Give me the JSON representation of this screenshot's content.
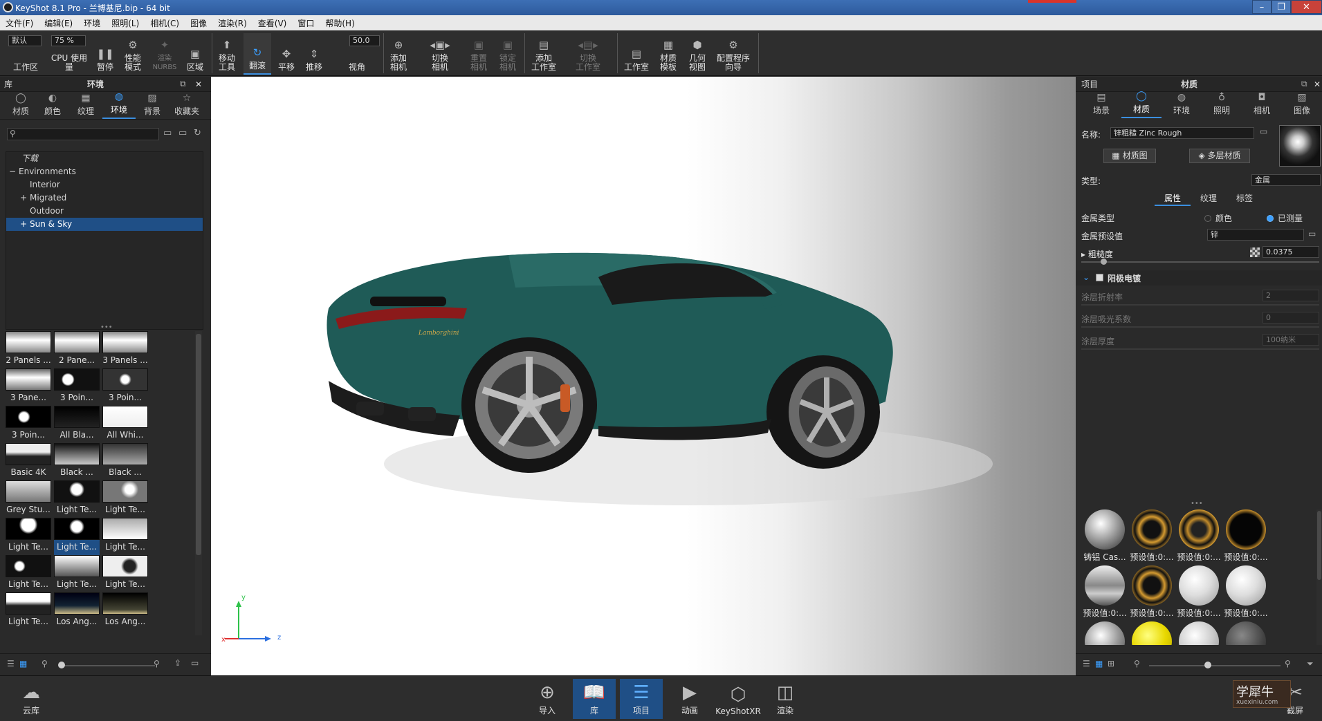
{
  "window": {
    "title": "KeyShot 8.1 Pro  - 兰博基尼.bip  - 64 bit"
  },
  "menu": [
    "文件(F)",
    "编辑(E)",
    "环境",
    "照明(L)",
    "相机(C)",
    "图像",
    "渲染(R)",
    "查看(V)",
    "窗口",
    "帮助(H)"
  ],
  "toolbar": {
    "workspace_select": "默认",
    "cpu_percent": "75 %",
    "fov_value": "50.0",
    "items": [
      {
        "label": "工作区"
      },
      {
        "label": "CPU 使用量"
      },
      {
        "label": "暂停"
      },
      {
        "label": "性能\n模式"
      },
      {
        "label": "渲染\nNURBS"
      },
      {
        "label": "区域"
      },
      {
        "label": "移动\n工具"
      },
      {
        "label": "翻滚"
      },
      {
        "label": "平移"
      },
      {
        "label": "推移"
      },
      {
        "label": "视角"
      },
      {
        "label": "添加\n相机"
      },
      {
        "label": "切换\n相机"
      },
      {
        "label": "重置\n相机"
      },
      {
        "label": "锁定\n相机"
      },
      {
        "label": "添加\n工作室"
      },
      {
        "label": "切换\n工作室"
      },
      {
        "label": "工作室"
      },
      {
        "label": "材质\n模板"
      },
      {
        "label": "几何\n视图"
      },
      {
        "label": "配置程序\n向导"
      }
    ]
  },
  "library": {
    "header_left": "库",
    "header_title": "环境",
    "tabs": [
      {
        "label": "材质"
      },
      {
        "label": "颜色"
      },
      {
        "label": "纹理"
      },
      {
        "label": "环境"
      },
      {
        "label": "背景"
      },
      {
        "label": "收藏夹"
      }
    ],
    "search_placeholder": "",
    "tree": [
      {
        "label": "下载",
        "indent": 1
      },
      {
        "label": "Environments",
        "indent": 0,
        "toggle": "−"
      },
      {
        "label": "Interior",
        "indent": 1
      },
      {
        "label": "Migrated",
        "indent": 1,
        "toggle": "+"
      },
      {
        "label": "Outdoor",
        "indent": 1
      },
      {
        "label": "Sun & Sky",
        "indent": 1,
        "toggle": "+"
      }
    ],
    "thumbs": [
      "2 Panels ...",
      "2 Pane...",
      "3 Panels ...",
      "3 Pane...",
      "3 Poin...",
      "3 Poin...",
      "3 Poin...",
      "All Bla...",
      "All Whi...",
      "Basic 4K",
      "Black ...",
      "Black ...",
      "Grey Stu...",
      "Light Te...",
      "Light Te...",
      "Light Te...",
      "Light Te...",
      "Light Te...",
      "Light Te...",
      "Light Te...",
      "Light Te...",
      "Light Te...",
      "Los Ang...",
      "Los Ang..."
    ]
  },
  "project": {
    "header_left": "项目",
    "header_title": "材质",
    "tabs": [
      {
        "label": "场景"
      },
      {
        "label": "材质"
      },
      {
        "label": "环境"
      },
      {
        "label": "照明"
      },
      {
        "label": "相机"
      },
      {
        "label": "图像"
      }
    ],
    "name_label": "名称:",
    "name_value": "锌粗糙 Zinc Rough",
    "btn_material_graph": "材质图",
    "btn_multilayer": "多层材质",
    "type_label": "类型:",
    "type_value": "金属",
    "subtabs": [
      {
        "label": "属性"
      },
      {
        "label": "纹理"
      },
      {
        "label": "标签"
      }
    ],
    "metal_type_label": "金属类型",
    "radio_color": "颜色",
    "radio_measured": "已测量",
    "preset_label": "金属预设值",
    "preset_value": "锌",
    "roughness_label": "粗糙度",
    "roughness_value": "0.0375",
    "anodized_label": "阳极电镀",
    "coat_ior_label": "涂层折射率",
    "coat_ior_value": "2",
    "coat_abs_label": "涂层吸光系数",
    "coat_abs_value": "0",
    "coat_thick_label": "涂层厚度",
    "coat_thick_value": "100纳米",
    "mat_thumbs": [
      "铸铝 Cas...",
      "预设值:0:...",
      "预设值:0:...",
      "预设值:0:...",
      "预设值:0:...",
      "预设值:0:...",
      "预设值:0:...",
      "预设值:0:..."
    ]
  },
  "viewport": {
    "axis_y": "y",
    "axis_z": "z",
    "car_badge": "Lamborghini"
  },
  "bottom": [
    {
      "label": "云库"
    },
    {
      "label": "导入"
    },
    {
      "label": "库"
    },
    {
      "label": "项目"
    },
    {
      "label": "动画"
    },
    {
      "label": "KeyShotXR"
    },
    {
      "label": "渲染"
    },
    {
      "label": "截屏"
    }
  ],
  "watermark": {
    "main": "学犀牛",
    "sub": "xuexiniu.com"
  }
}
